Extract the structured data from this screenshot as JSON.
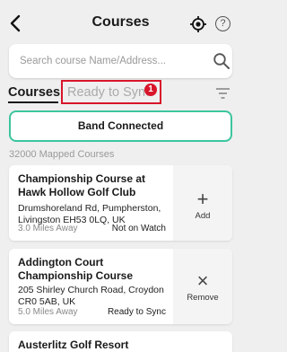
{
  "header": {
    "title": "Courses",
    "back_icon": "back-arrow-icon",
    "location_icon": "crosshair-location-icon",
    "help_label": "?"
  },
  "search": {
    "placeholder": "Search course Name/Address...",
    "value": "",
    "icon": "search-icon"
  },
  "tabs": {
    "courses_label": "Courses",
    "sync_label": "Ready to Sync",
    "sync_badge": "1"
  },
  "band_button": {
    "label": "Band Connected"
  },
  "mapped_count": "32000 Mapped Courses",
  "courses": [
    {
      "name": "Championship Course at Hawk Hollow Golf Club",
      "address": "Drumshoreland Rd, Pumpherston, Livingston EH53 0LQ, UK",
      "distance": "3.0 Miles Away",
      "status": "Not on Watch",
      "action_glyph": "+",
      "action_label": "Add"
    },
    {
      "name": "Addington Court Championship Course",
      "address": "205 Shirley Church Road, Croydon CR0 5AB, UK",
      "distance": "5.0 Miles Away",
      "status": "Ready to Sync",
      "action_glyph": "×",
      "action_label": "Remove"
    },
    {
      "name": "Austerlitz Golf Resort"
    }
  ],
  "colors": {
    "accent_red": "#d8152b",
    "band_border": "#3cc59e",
    "background": "#efefef"
  }
}
